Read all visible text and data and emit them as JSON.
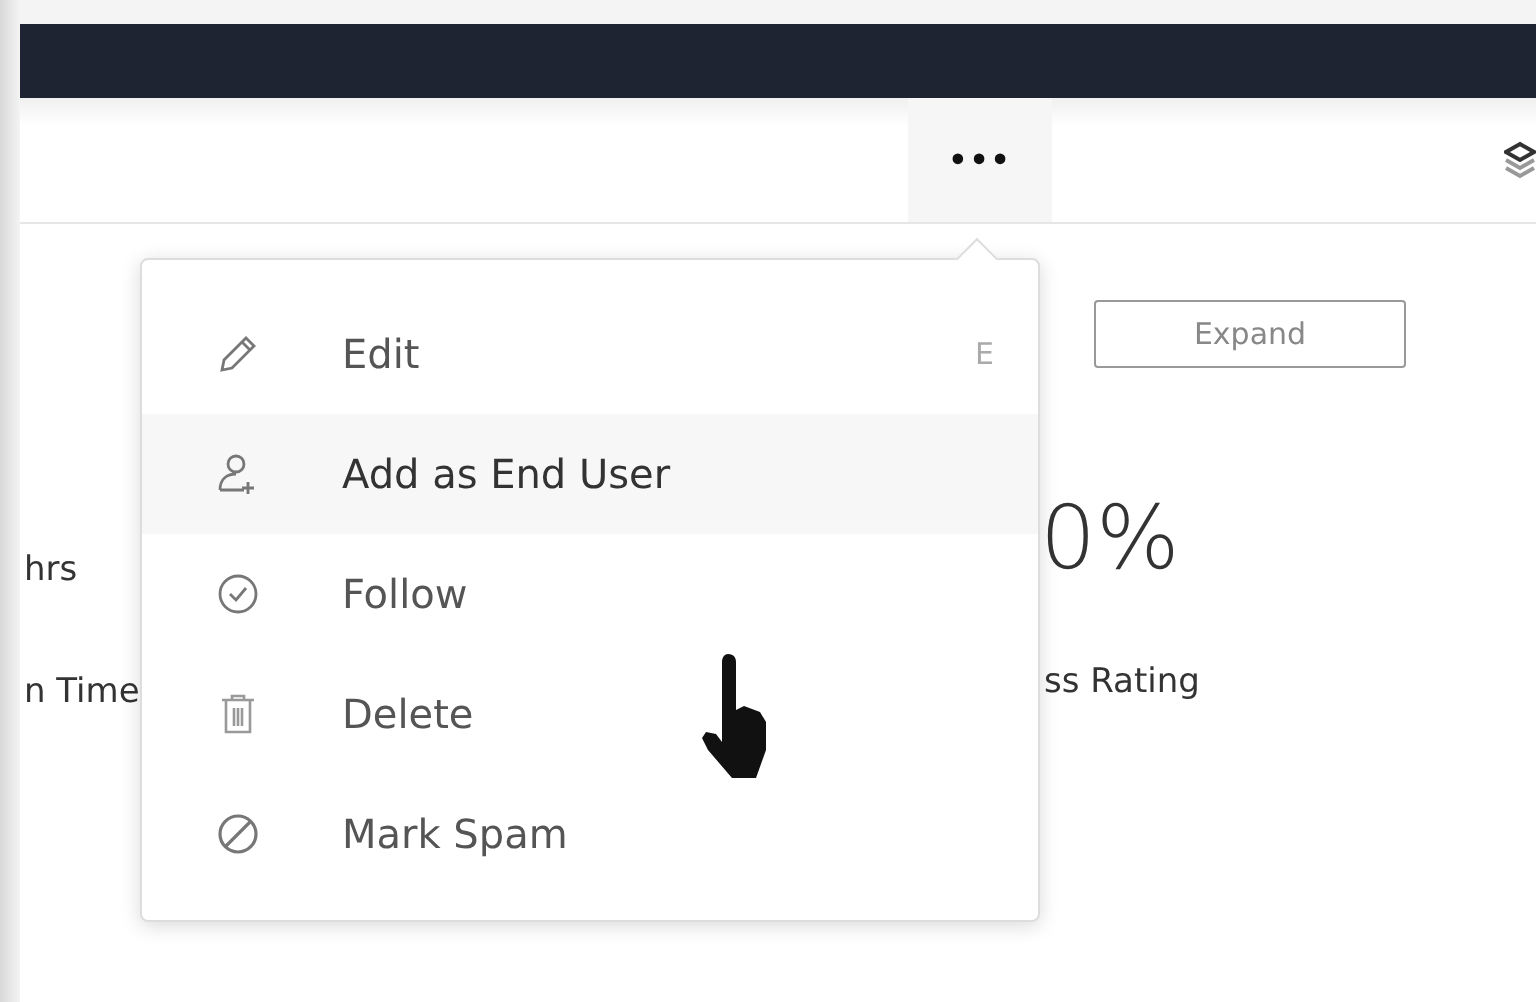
{
  "toolbar": {
    "more_button": "•••"
  },
  "stats": [
    {
      "label": "hrs"
    },
    {
      "label": "n Time"
    }
  ],
  "expand_button": "Expand",
  "metric": {
    "value": "0%",
    "label": "ss Rating"
  },
  "menu": {
    "items": [
      {
        "label": "Edit",
        "shortcut": "E",
        "hovered": false
      },
      {
        "label": "Add as End User",
        "hovered": true
      },
      {
        "label": "Follow",
        "hovered": false
      },
      {
        "label": "Delete",
        "hovered": false
      },
      {
        "label": "Mark Spam",
        "hovered": false
      }
    ]
  }
}
